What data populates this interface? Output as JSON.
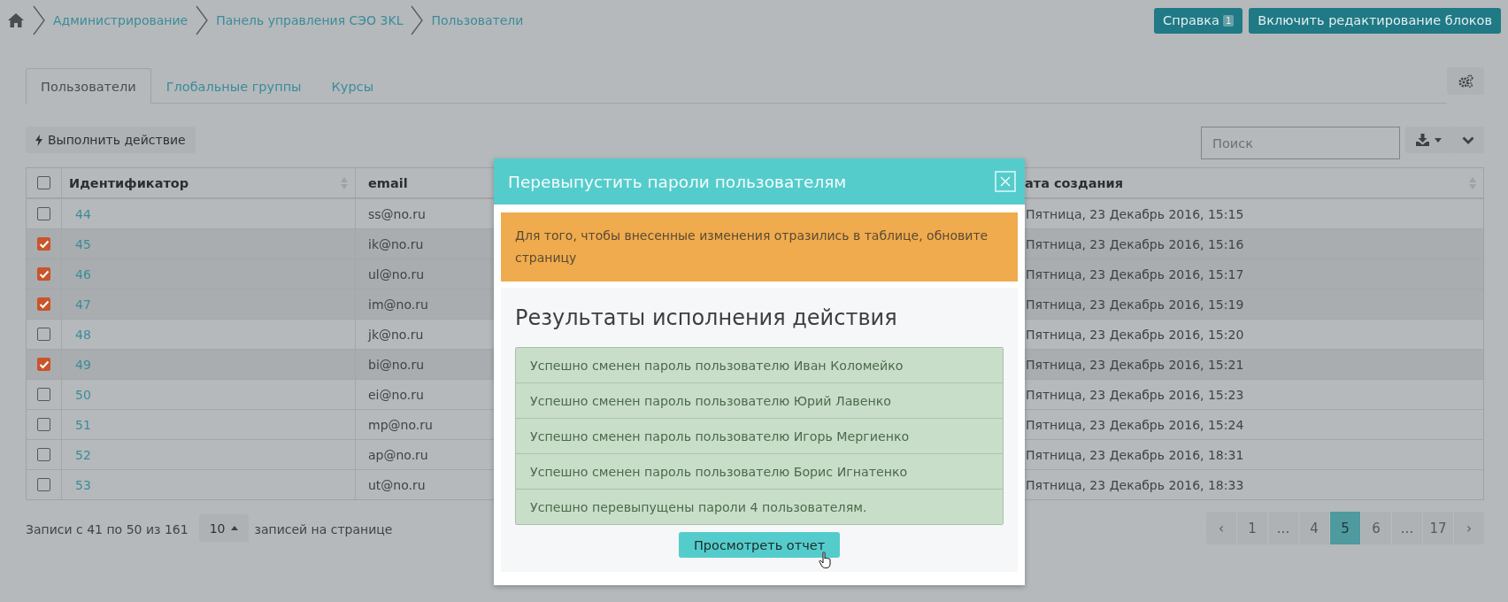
{
  "breadcrumb": {
    "items": [
      {
        "label": "Администрирование"
      },
      {
        "label": "Панель управления СЭО 3KL"
      },
      {
        "label": "Пользователи"
      }
    ]
  },
  "header_buttons": [
    {
      "kind": "badge",
      "label": "Справка",
      "badge": "1"
    },
    {
      "kind": "plain",
      "label": "Включить редактирование блоков"
    }
  ],
  "tabs": [
    {
      "label": "Пользователи",
      "selected": true
    },
    {
      "label": "Глобальные группы",
      "selected": false
    },
    {
      "label": "Курсы",
      "selected": false
    }
  ],
  "action_button": {
    "label": "Выполнить действие"
  },
  "search": {
    "placeholder": "Поиск"
  },
  "table": {
    "select_all": {
      "checked": false
    },
    "columns": [
      "Идентификатор",
      "email",
      "ата создания"
    ],
    "rows": [
      {
        "selected": false,
        "id": "44",
        "email": "ss@no.ru",
        "created": "Пятница, 23 Декабрь 2016, 15:15"
      },
      {
        "selected": true,
        "id": "45",
        "email": "ik@no.ru",
        "created": "Пятница, 23 Декабрь 2016, 15:16"
      },
      {
        "selected": true,
        "id": "46",
        "email": "ul@no.ru",
        "created": "Пятница, 23 Декабрь 2016, 15:17"
      },
      {
        "selected": true,
        "id": "47",
        "email": "im@no.ru",
        "created": "Пятница, 23 Декабрь 2016, 15:19"
      },
      {
        "selected": false,
        "id": "48",
        "email": "jk@no.ru",
        "created": "Пятница, 23 Декабрь 2016, 15:20"
      },
      {
        "selected": true,
        "id": "49",
        "email": "bi@no.ru",
        "created": "Пятница, 23 Декабрь 2016, 15:21"
      },
      {
        "selected": false,
        "id": "50",
        "email": "ei@no.ru",
        "created": "Пятница, 23 Декабрь 2016, 15:23"
      },
      {
        "selected": false,
        "id": "51",
        "email": "mp@no.ru",
        "created": "Пятница, 23 Декабрь 2016, 15:24"
      },
      {
        "selected": false,
        "id": "52",
        "email": "ap@no.ru",
        "created": "Пятница, 23 Декабрь 2016, 18:31"
      },
      {
        "selected": false,
        "id": "53",
        "email": "ut@no.ru",
        "created": "Пятница, 23 Декабрь 2016, 18:33"
      }
    ]
  },
  "footer": {
    "records": "Записи с 41 по 50 из 161",
    "per_page": "10",
    "per_page_suffix": "записей на странице"
  },
  "pagination": [
    {
      "label": "‹",
      "selected": false
    },
    {
      "label": "1",
      "selected": false
    },
    {
      "label": "...",
      "selected": false
    },
    {
      "label": "4",
      "selected": false
    },
    {
      "label": "5",
      "selected": true
    },
    {
      "label": "6",
      "selected": false
    },
    {
      "label": "...",
      "selected": false
    },
    {
      "label": "17",
      "selected": false
    },
    {
      "label": "›",
      "selected": false
    }
  ],
  "modal": {
    "title": "Перевыпустить пароли пользователям",
    "warning": "Для того, чтобы внесенные изменения отразились в таблице, обновите страницу",
    "results_title": "Результаты исполнения действия",
    "results": [
      "Успешно сменен пароль пользователю Иван Коломейко",
      "Успешно сменен пароль пользователю Юрий Лавенко",
      "Успешно сменен пароль пользователю Игорь Мергиенко",
      "Успешно сменен пароль пользователю Борис Игнатенко",
      "Успешно перевыпущены пароли 4 пользователям."
    ],
    "button": "Просмотреть отчет"
  }
}
